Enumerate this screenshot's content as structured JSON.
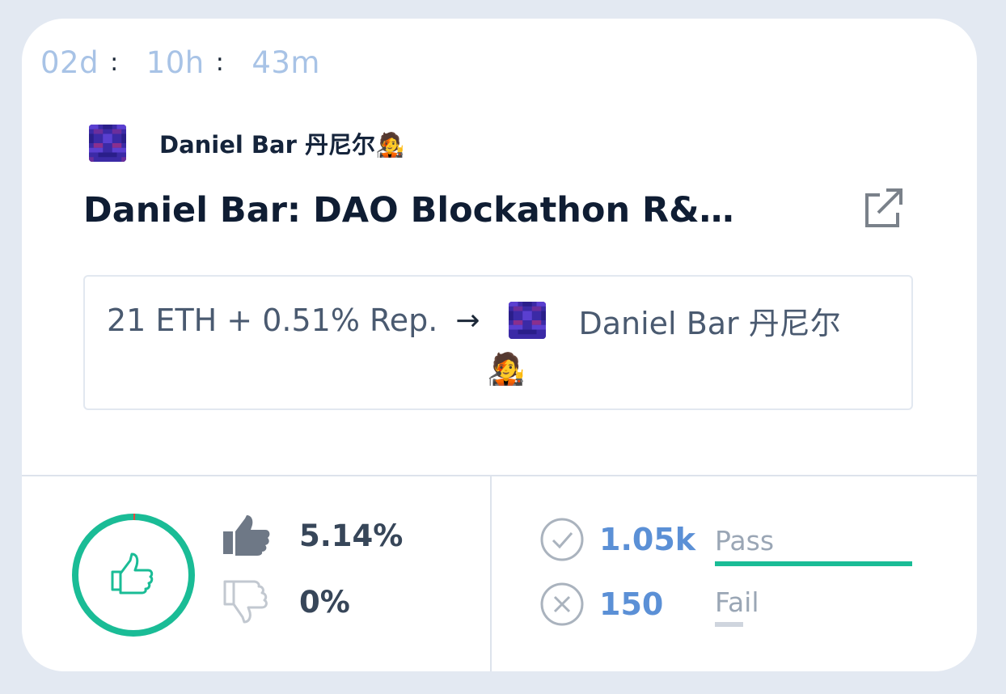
{
  "countdown": {
    "days": "02d",
    "hours": "10h",
    "minutes": "43m",
    "separator": ":"
  },
  "author": {
    "name": "Daniel Bar 丹尼尔",
    "emoji": "🧑‍🎤",
    "avatar": "pixel-avatar-purple"
  },
  "proposal": {
    "title": "Daniel Bar: DAO Blockathon R&D wor…",
    "link_icon": "external-link-icon"
  },
  "payout": {
    "amount": "21 ETH + 0.51% Rep.",
    "arrow": "→",
    "recipient_name": "Daniel Bar 丹尼尔",
    "recipient_emoji": "🧑‍🎤"
  },
  "votes": {
    "for_pct": "5.14%",
    "against_pct": "0%",
    "for_fraction": 0.0514,
    "for_icon": "thumbs-up-icon",
    "against_icon": "thumbs-down-icon"
  },
  "stakes": {
    "pass_count": "1.05k",
    "pass_label": "Pass",
    "fail_count": "150",
    "fail_label": "Fail",
    "pass_color": "#1abc96",
    "fail_color": "#cfd5de"
  },
  "colors": {
    "accent_green": "#1abc96",
    "timer_blue": "#a8c3e6",
    "count_blue": "#5b90d6",
    "ring_red": "#e8473b"
  }
}
